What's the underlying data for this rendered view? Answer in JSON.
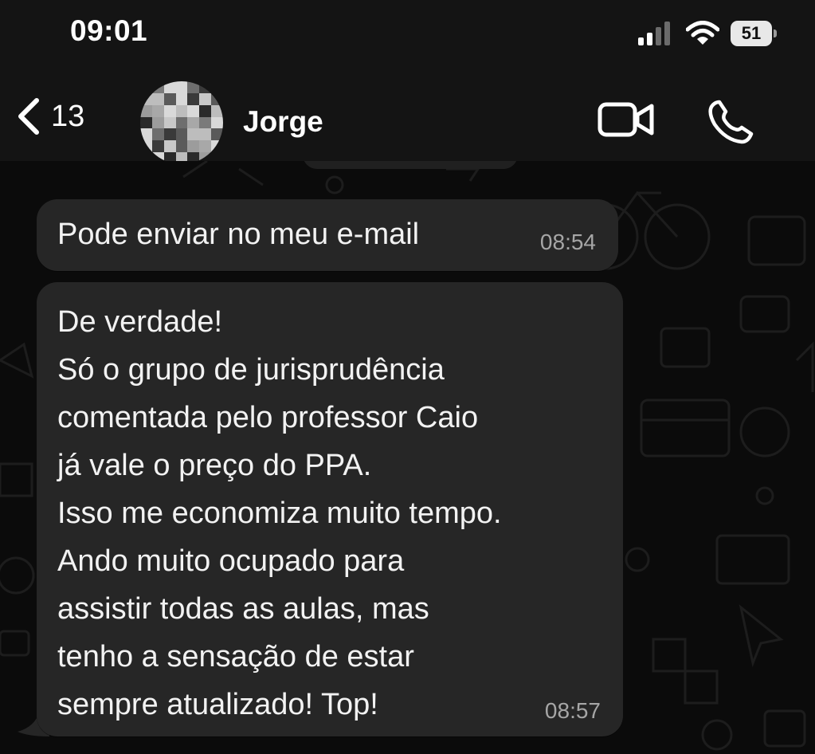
{
  "status_bar": {
    "time": "09:01",
    "battery": "51"
  },
  "header": {
    "back_count": "13",
    "contact_name": "Jorge"
  },
  "messages": [
    {
      "text": "Pode enviar no meu e-mail",
      "time": "08:54"
    },
    {
      "lines": [
        "De verdade!",
        "Só o grupo de jurisprudência",
        "comentada pelo professor Caio",
        "já vale o preço do PPA.",
        "Isso me economiza muito tempo.",
        "Ando muito ocupado para",
        "assistir todas as aulas, mas",
        "tenho a sensação de estar",
        "sempre atualizado! Top!"
      ],
      "time": "08:57"
    }
  ],
  "icons": {
    "signal": "cellular-signal-icon",
    "wifi": "wifi-icon",
    "battery": "battery-icon",
    "back": "chevron-left-icon",
    "video": "video-camera-icon",
    "call": "phone-icon"
  },
  "colors": {
    "background": "#0b0b0b",
    "header": "#141414",
    "bubble": "#262626",
    "text": "#f2f2f2",
    "timestamp": "#a6a6a6"
  }
}
